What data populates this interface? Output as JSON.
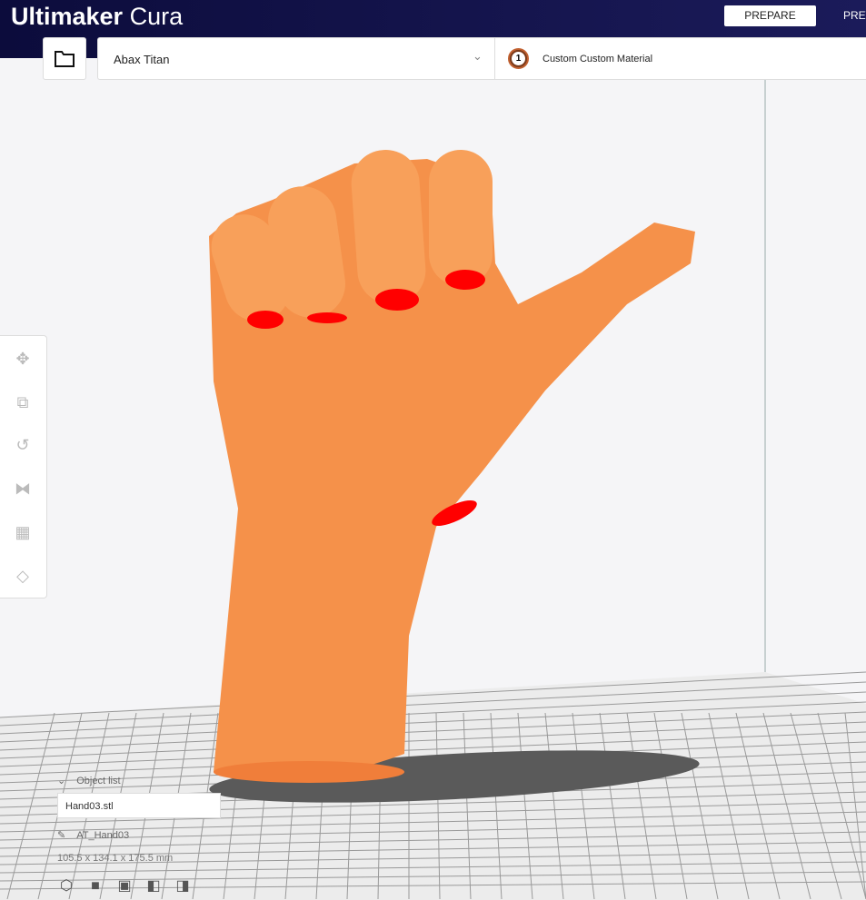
{
  "header": {
    "brand_bold": "Ultimaker",
    "brand_light": "Cura",
    "stages": [
      {
        "label": "PREPARE",
        "active": true
      },
      {
        "label": "PREV"
      }
    ]
  },
  "toolbar_top": {
    "printer": "Abax Titan",
    "extruder_number": "1",
    "material": "Custom Custom Material"
  },
  "tools": [
    "move-icon",
    "scale-icon",
    "rotate-icon",
    "mirror-icon",
    "per-model-settings-icon",
    "support-blocker-icon"
  ],
  "object_list": {
    "title": "Object list",
    "file": "Hand03.stl",
    "object_name": "AT_Hand03",
    "dimensions": "105.5 x 134.1 x 175.5 mm"
  },
  "colors": {
    "header": "#0c0c3c",
    "model": "#f5914a",
    "overhang": "#ff0000"
  }
}
